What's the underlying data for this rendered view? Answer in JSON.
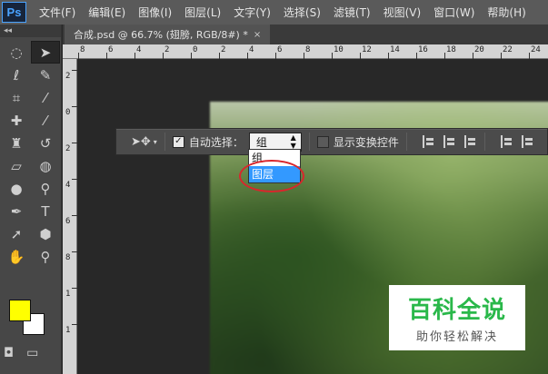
{
  "app": {
    "logo": "Ps"
  },
  "menu": [
    "文件(F)",
    "编辑(E)",
    "图像(I)",
    "图层(L)",
    "文字(Y)",
    "选择(S)",
    "滤镜(T)",
    "视图(V)",
    "窗口(W)",
    "帮助(H)"
  ],
  "document_tab": {
    "title": "合成.psd @ 66.7% (翅膀, RGB/8#) *",
    "close": "×"
  },
  "toolbox": {
    "header": "◂◂",
    "tools": [
      "select-marquee-icon",
      "move-icon",
      "lasso-icon",
      "quick-select-icon",
      "crop-icon",
      "eyedropper-icon",
      "healing-brush-icon",
      "brush-icon",
      "clone-stamp-icon",
      "history-brush-icon",
      "eraser-icon",
      "paint-bucket-icon",
      "blur-icon",
      "dodge-icon",
      "pen-icon",
      "type-icon",
      "path-select-icon",
      "shape-icon",
      "hand-icon",
      "zoom-icon"
    ],
    "foreground_color": "#ffff00",
    "background_color": "#ffffff"
  },
  "ruler": {
    "top_labels": [
      "8",
      "6",
      "4",
      "2",
      "0",
      "2",
      "4",
      "6",
      "8",
      "10",
      "12",
      "14",
      "16",
      "18",
      "20",
      "22",
      "24"
    ],
    "left_labels": [
      "2",
      "0",
      "2",
      "4",
      "6",
      "8",
      "1",
      "1"
    ]
  },
  "options_bar": {
    "auto_select_label": "自动选择：",
    "auto_select_checked": true,
    "select_value": "组",
    "show_transform_label": "显示变换控件",
    "show_transform_checked": false
  },
  "dropdown": {
    "options": [
      "组",
      "图层"
    ],
    "highlighted": "图层"
  },
  "watermark": {
    "title": "百科全说",
    "subtitle": "助你轻松解决"
  }
}
